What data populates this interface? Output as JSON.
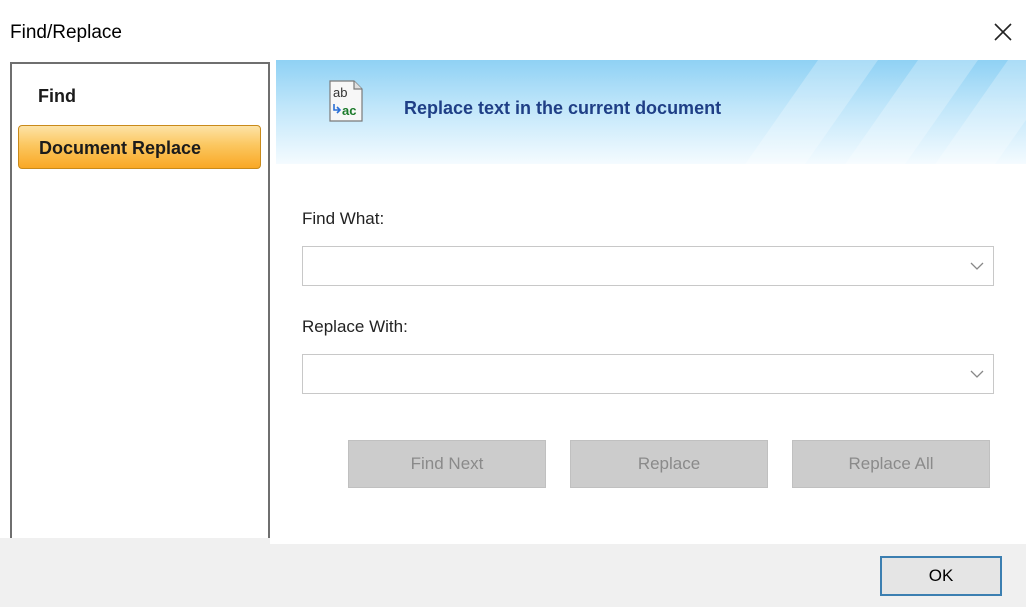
{
  "window": {
    "title": "Find/Replace"
  },
  "sidebar": {
    "items": [
      {
        "label": "Find",
        "active": false
      },
      {
        "label": "Document Replace",
        "active": true
      }
    ]
  },
  "banner": {
    "icon": "replace-text-icon",
    "text": "Replace text in the current document"
  },
  "form": {
    "find_label": "Find What:",
    "find_value": "",
    "replace_label": "Replace With:",
    "replace_value": ""
  },
  "actions": {
    "find_next": "Find Next",
    "replace": "Replace",
    "replace_all": "Replace All"
  },
  "footer": {
    "ok": "OK"
  },
  "colors": {
    "accent_orange": "#f9a825",
    "banner_text": "#1f3f86",
    "focus_border": "#3c7fb1"
  }
}
